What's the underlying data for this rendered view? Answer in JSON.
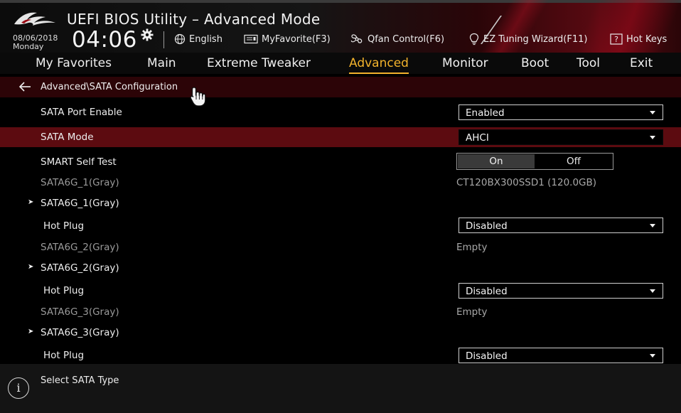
{
  "header": {
    "title": "UEFI BIOS Utility – Advanced Mode",
    "date": "08/06/2018",
    "day": "Monday",
    "time": "04:06",
    "toolbar": [
      {
        "label": "English",
        "icon": "globe-icon"
      },
      {
        "label": "MyFavorite(F3)",
        "icon": "favorite-icon"
      },
      {
        "label": "Qfan Control(F6)",
        "icon": "fan-icon"
      },
      {
        "label": "EZ Tuning Wizard(F11)",
        "icon": "bulb-icon"
      },
      {
        "label": "Hot Keys",
        "icon": "question-icon"
      }
    ]
  },
  "tabs": [
    {
      "label": "My Favorites",
      "active": false
    },
    {
      "label": "Main",
      "active": false
    },
    {
      "label": "Extreme Tweaker",
      "active": false
    },
    {
      "label": "Advanced",
      "active": true
    },
    {
      "label": "Monitor",
      "active": false
    },
    {
      "label": "Boot",
      "active": false
    },
    {
      "label": "Tool",
      "active": false
    },
    {
      "label": "Exit",
      "active": false
    }
  ],
  "breadcrumb": "Advanced\\SATA Configuration",
  "settings": {
    "sata_port_enable": {
      "label": "SATA Port Enable",
      "value": "Enabled"
    },
    "sata_mode": {
      "label": "SATA Mode",
      "value": "AHCI"
    },
    "smart_self_test": {
      "label": "SMART Self Test",
      "on": "On",
      "off": "Off",
      "selected": "On"
    },
    "port1_info": {
      "label": "SATA6G_1(Gray)",
      "value": "CT120BX300SSD1 (120.0GB)"
    },
    "port1_submenu": {
      "label": "SATA6G_1(Gray)"
    },
    "port1_hotplug": {
      "label": "Hot Plug",
      "value": "Disabled"
    },
    "port2_info": {
      "label": "SATA6G_2(Gray)",
      "value": "Empty"
    },
    "port2_submenu": {
      "label": "SATA6G_2(Gray)"
    },
    "port2_hotplug": {
      "label": "Hot Plug",
      "value": "Disabled"
    },
    "port3_info": {
      "label": "SATA6G_3(Gray)",
      "value": "Empty"
    },
    "port3_submenu": {
      "label": "SATA6G_3(Gray)"
    },
    "port3_hotplug": {
      "label": "Hot Plug",
      "value": "Disabled"
    }
  },
  "help": {
    "text": "Select SATA Type",
    "icon": "info-icon"
  },
  "colors": {
    "accent": "#f2b22c",
    "highlight_row": "#5c0b10",
    "brand_red": "#c8142a"
  }
}
